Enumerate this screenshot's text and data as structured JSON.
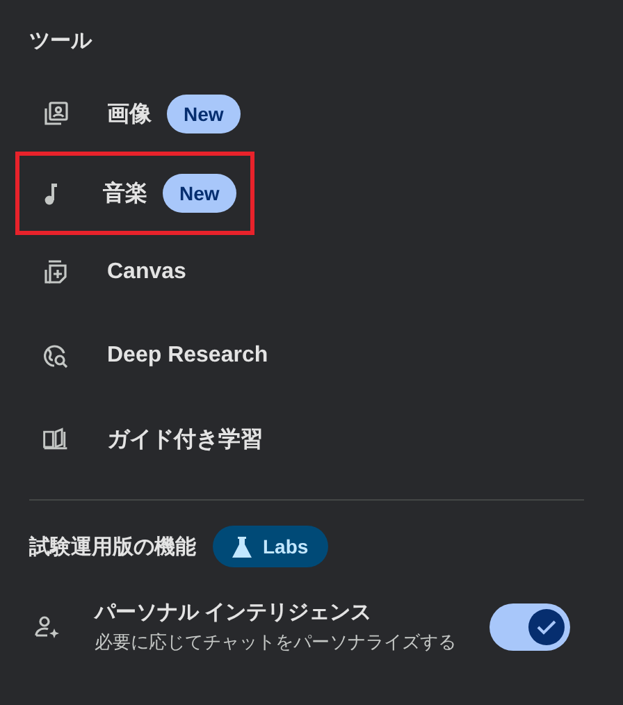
{
  "tools": {
    "title": "ツール",
    "items": [
      {
        "kind": "image",
        "label": "画像",
        "badge": "New",
        "highlighted": false
      },
      {
        "kind": "music",
        "label": "音楽",
        "badge": "New",
        "highlighted": true
      },
      {
        "kind": "canvas",
        "label": "Canvas",
        "highlighted": false
      },
      {
        "kind": "research",
        "label": "Deep Research",
        "highlighted": false
      },
      {
        "kind": "learning",
        "label": "ガイド付き学習",
        "highlighted": false
      }
    ]
  },
  "labs": {
    "title": "試験運用版の機能",
    "badge": "Labs",
    "features": [
      {
        "title": "パーソナル インテリジェンス",
        "description": "必要に応じてチャットをパーソナライズする",
        "on": true
      }
    ]
  }
}
